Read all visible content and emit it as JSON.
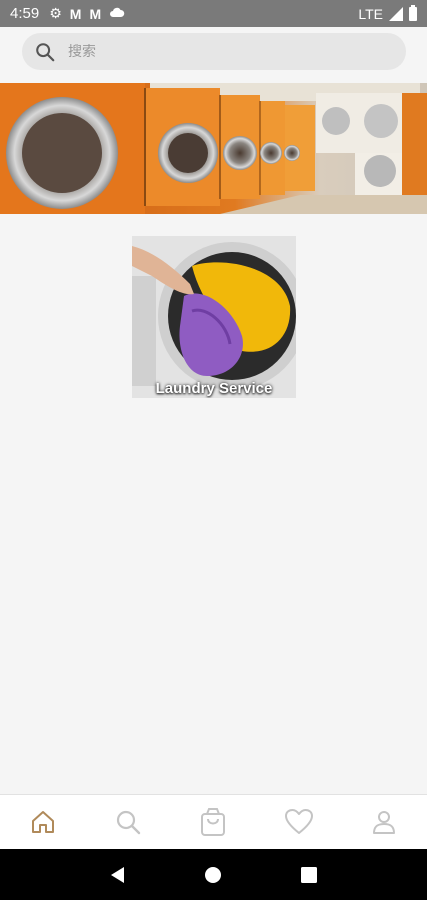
{
  "status_bar": {
    "time": "4:59",
    "icons": [
      "settings-icon",
      "gmail-icon",
      "gmail-icon",
      "cloud-icon"
    ],
    "network": "LTE"
  },
  "search": {
    "placeholder": "搜索"
  },
  "banner": {
    "image": "laundromat-washing-machines"
  },
  "categories": [
    {
      "label": "Laundry Service",
      "image": "laundry-clothes-in-washer"
    }
  ],
  "bottom_nav": {
    "items": [
      {
        "icon": "home-icon",
        "active": true
      },
      {
        "icon": "search-icon",
        "active": false
      },
      {
        "icon": "shopping-bag-icon",
        "active": false
      },
      {
        "icon": "heart-icon",
        "active": false
      },
      {
        "icon": "user-icon",
        "active": false
      }
    ],
    "active_color": "#b08a5a",
    "inactive_color": "#c4c4c4"
  },
  "system_nav": [
    "back-icon",
    "home-circle-icon",
    "recents-icon"
  ]
}
